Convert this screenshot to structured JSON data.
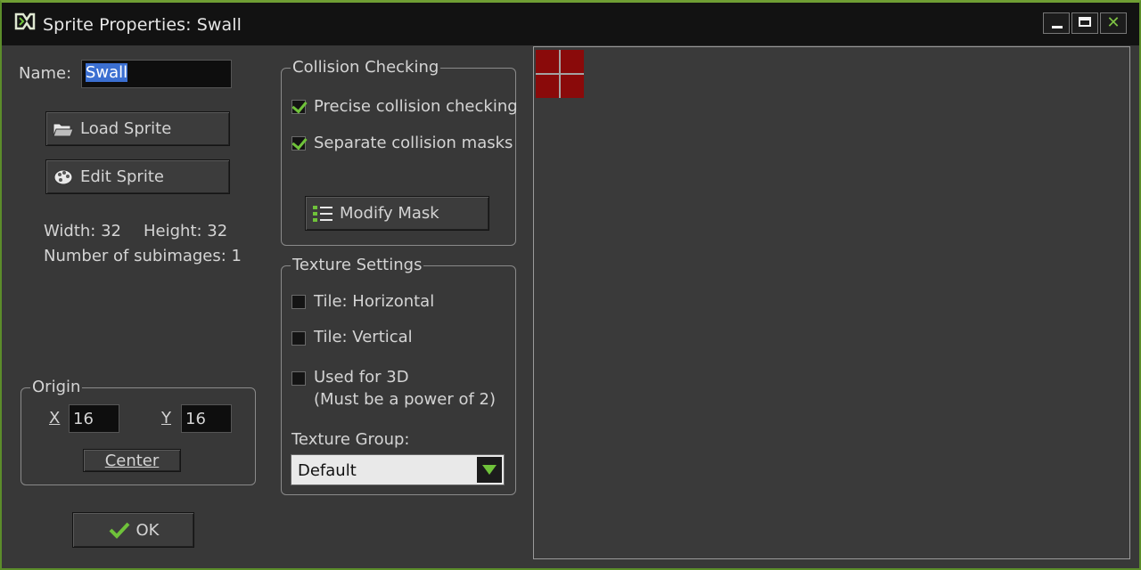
{
  "window": {
    "title": "Sprite Properties: Swall",
    "icon": "gamemaker-logo-icon",
    "accent_color": "#6f9e34"
  },
  "name": {
    "label": "Name:",
    "value": "Swall"
  },
  "buttons": {
    "load_sprite": "Load Sprite",
    "edit_sprite": "Edit Sprite",
    "modify_mask": "Modify Mask",
    "center": "Center",
    "ok": "OK"
  },
  "info": {
    "width": "Width: 32",
    "height": "Height: 32",
    "subimages": "Number of subimages: 1"
  },
  "origin": {
    "title": "Origin",
    "x_label": "X",
    "x_value": "16",
    "y_label": "Y",
    "y_value": "16"
  },
  "collision": {
    "title": "Collision Checking",
    "precise": {
      "label": "Precise collision checking",
      "checked": true
    },
    "separate": {
      "label": "Separate collision masks",
      "checked": true
    }
  },
  "texture": {
    "title": "Texture Settings",
    "tile_h": {
      "label": "Tile: Horizontal",
      "checked": false
    },
    "tile_v": {
      "label": "Tile: Vertical",
      "checked": false
    },
    "used3d": {
      "label": "Used for 3D",
      "note": "(Must be a power of 2)",
      "checked": false
    },
    "group_label": "Texture Group:",
    "group_value": "Default"
  },
  "preview": {
    "sprite_color": "#8a0a0a"
  }
}
